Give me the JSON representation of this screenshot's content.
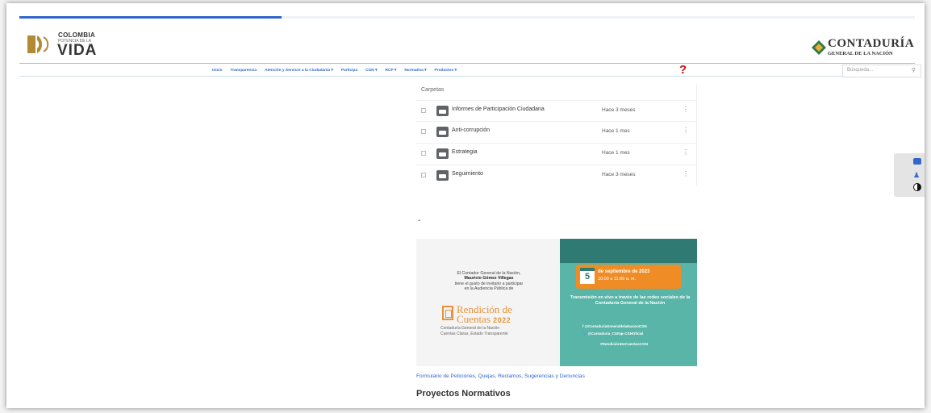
{
  "header": {
    "logo": {
      "line1": "COLOMBIA",
      "line2": "POTENCIA DE LA",
      "line3": "VIDA"
    },
    "cgn_logo": {
      "line1": "CONTADURÍA",
      "line2": "GENERAL DE LA NACIÓN"
    }
  },
  "nav": {
    "items": [
      "Inicio",
      "Transparencia",
      "Atención y Servicio a la Ciudadanía ▾",
      "Participa",
      "CGN ▾",
      "RCP ▾",
      "Normativa ▾",
      "Productos ▾"
    ],
    "help": "?",
    "search_placeholder": "Búsqueda...",
    "search_icon": "magnifier-icon"
  },
  "folders": {
    "heading": "Carpetas",
    "rows": [
      {
        "name": "Informes de Participación Ciudadana",
        "date": "Hace 3 meses"
      },
      {
        "name": "Anti-corrupción",
        "date": "Hace 1 mes"
      },
      {
        "name": "Estrategia",
        "date": "Hace 1 mes"
      },
      {
        "name": "Seguimiento",
        "date": "Hace 3 meses"
      }
    ],
    "more_glyph": "⋮"
  },
  "separator": "-",
  "banner": {
    "invite_line1": "El Contador General de la Nación,",
    "invite_name": "Mauricio Gómez Villegas",
    "invite_line2": "tiene el gusto de invitarlo a participar",
    "invite_line3": "en la Audiencia Pública de",
    "rendicion_1": "Rendición de",
    "rendicion_2": "Cuentas",
    "year": "2022",
    "sub1": "Contaduría General de la Nación",
    "sub2": "Cuentas Claras, Estado Transparente",
    "date_day": "5",
    "date_text": "de septiembre de 2023",
    "date_time": "10:00 a 11:00 a. m.",
    "transmission": "Transmisión en vivo a través de las redes sociales de la Contaduría General de la Nación",
    "social1": "f @ContaduriaGeneraldelaNacionCGN",
    "social2": "🐦 @Contaduria_CGN   ▶ CGNOficial",
    "hashtag": "#RendiciónDeCuentasCGN"
  },
  "pqrsd_link": "Formulario de Peticiones, Quejas, Reclamos, Sugerencias y Denuncias",
  "projects_heading": "Proyectos Normativos",
  "colors": {
    "accent": "#3366cc",
    "teal": "#58b5a8",
    "orange": "#f08c25",
    "help": "#d01010"
  }
}
